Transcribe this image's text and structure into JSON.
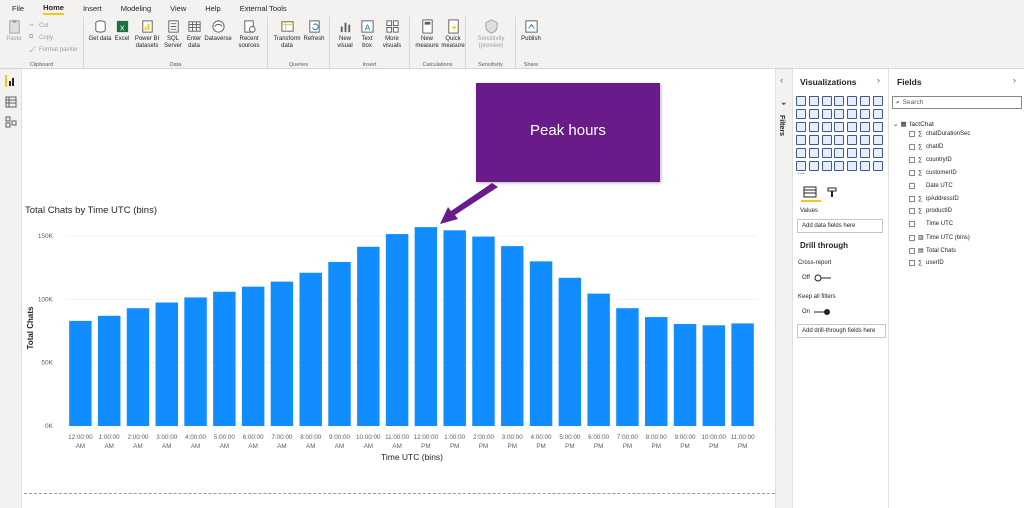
{
  "menu": [
    "File",
    "Home",
    "Insert",
    "Modeling",
    "View",
    "Help",
    "External Tools"
  ],
  "menu_active": "Home",
  "ribbon": {
    "clipboard": {
      "paste": "Paste",
      "cut": "Cut",
      "copy": "Copy",
      "format_painter": "Format painter",
      "label": "Clipboard"
    },
    "data": {
      "get_data": "Get data",
      "excel": "Excel",
      "powerbi": "Power BI datasets",
      "sql": "SQL Server",
      "enter": "Enter data",
      "dataverse": "Dataverse",
      "recent": "Recent sources",
      "label": "Data"
    },
    "queries": {
      "transform": "Transform data",
      "refresh": "Refresh",
      "label": "Queries"
    },
    "insert": {
      "new_visual": "New visual",
      "text_box": "Text box",
      "more_visuals": "More visuals",
      "label": "Insert"
    },
    "calculations": {
      "new_measure": "New measure",
      "quick_measure": "Quick measure",
      "label": "Calculations"
    },
    "sensitivity": {
      "btn": "Sensitivity (preview)",
      "label": "Sensitivity"
    },
    "share": {
      "publish": "Publish",
      "label": "Share"
    }
  },
  "callout": "Peak hours",
  "chart_data": {
    "type": "bar",
    "title": "Total Chats by Time UTC (bins)",
    "xlabel": "Time UTC (bins)",
    "ylabel": "Total Chats",
    "ylim": [
      0,
      160000
    ],
    "yticks": [
      "0K",
      "50K",
      "100K",
      "150K"
    ],
    "categories": [
      "12:00:00 AM",
      "1:00:00 AM",
      "2:00:00 AM",
      "3:00:00 AM",
      "4:00:00 AM",
      "5:00:00 AM",
      "6:00:00 AM",
      "7:00:00 AM",
      "8:00:00 AM",
      "9:00:00 AM",
      "10:00:00 AM",
      "11:00:00 AM",
      "12:00:00 PM",
      "1:00:00 PM",
      "2:00:00 PM",
      "3:00:00 PM",
      "4:00:00 PM",
      "5:00:00 PM",
      "6:00:00 PM",
      "7:00:00 PM",
      "8:00:00 PM",
      "9:00:00 PM",
      "10:00:00 PM",
      "11:00:00 PM"
    ],
    "values": [
      83000,
      87000,
      93000,
      97500,
      101500,
      106000,
      110000,
      114000,
      121000,
      129500,
      141500,
      151500,
      157000,
      154500,
      149500,
      142000,
      130000,
      117000,
      104500,
      93000,
      86000,
      80500,
      79500,
      81000
    ],
    "color": "#118dff"
  },
  "viz": {
    "title": "Visualizations",
    "values": "Values",
    "add_fields": "Add data fields here",
    "drill": "Drill through",
    "cross": "Cross-report",
    "off": "Off",
    "keep": "Keep all filters",
    "on": "On",
    "add_drill": "Add drill-through fields here"
  },
  "filters_label": "Filters",
  "fields": {
    "title": "Fields",
    "search": "Search",
    "table": "factChat",
    "items": [
      {
        "name": "chatDurationSec",
        "sigma": "∑"
      },
      {
        "name": "chatID",
        "sigma": "∑"
      },
      {
        "name": "countryID",
        "sigma": "∑"
      },
      {
        "name": "customerID",
        "sigma": "∑"
      },
      {
        "name": "Date UTC",
        "sigma": ""
      },
      {
        "name": "ipAddressID",
        "sigma": "∑"
      },
      {
        "name": "productID",
        "sigma": "∑"
      },
      {
        "name": "Time UTC",
        "sigma": ""
      },
      {
        "name": "Time UTC (bins)",
        "sigma": "▥"
      },
      {
        "name": "Total Chats",
        "sigma": "▤"
      },
      {
        "name": "userID",
        "sigma": "∑"
      }
    ]
  }
}
